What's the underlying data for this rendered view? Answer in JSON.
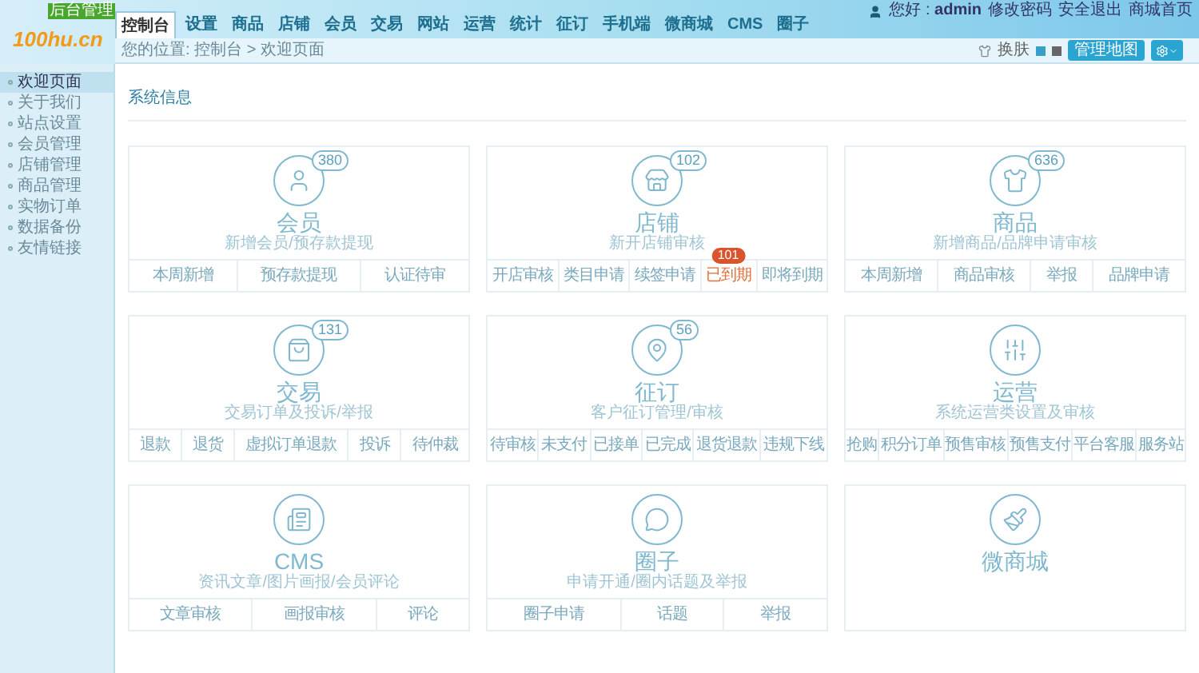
{
  "logo": {
    "text": "100hu.cn",
    "tag": "后台管理"
  },
  "nav": [
    {
      "label": "控制台",
      "selected": true
    },
    {
      "label": "设置",
      "selected": false
    },
    {
      "label": "商品",
      "selected": false
    },
    {
      "label": "店铺",
      "selected": false
    },
    {
      "label": "会员",
      "selected": false
    },
    {
      "label": "交易",
      "selected": false
    },
    {
      "label": "网站",
      "selected": false
    },
    {
      "label": "运营",
      "selected": false
    },
    {
      "label": "统计",
      "selected": false
    },
    {
      "label": "征订",
      "selected": false
    },
    {
      "label": "手机端",
      "selected": false
    },
    {
      "label": "微商城",
      "selected": false
    },
    {
      "label": "CMS",
      "selected": false
    },
    {
      "label": "圈子",
      "selected": false
    }
  ],
  "user": {
    "greeting": "您好 : ",
    "name": "admin",
    "links": [
      "修改密码",
      "安全退出",
      "商城首页"
    ]
  },
  "breadcrumb": "您的位置: 控制台 > 欢迎页面",
  "toolbar": {
    "skin": "换肤",
    "map_button": "管理地图"
  },
  "sidebar": [
    {
      "label": "欢迎页面",
      "selected": true
    },
    {
      "label": "关于我们",
      "selected": false
    },
    {
      "label": "站点设置",
      "selected": false
    },
    {
      "label": "会员管理",
      "selected": false
    },
    {
      "label": "店铺管理",
      "selected": false
    },
    {
      "label": "商品管理",
      "selected": false
    },
    {
      "label": "实物订单",
      "selected": false
    },
    {
      "label": "数据备份",
      "selected": false
    },
    {
      "label": "友情链接",
      "selected": false
    }
  ],
  "section_title": "系统信息",
  "cards": [
    {
      "kind": "user",
      "title": "会员",
      "count": "380",
      "desc": "新增会员/预存款提现",
      "links": [
        {
          "label": "本周新增"
        },
        {
          "label": "预存款提现"
        },
        {
          "label": "认证待审"
        }
      ]
    },
    {
      "kind": "store",
      "title": "店铺",
      "count": "102",
      "desc": "新开店铺审核",
      "links": [
        {
          "label": "开店审核"
        },
        {
          "label": "类目申请"
        },
        {
          "label": "续签申请"
        },
        {
          "label": "已到期",
          "badge": "101"
        },
        {
          "label": "即将到期"
        }
      ]
    },
    {
      "kind": "shirt",
      "title": "商品",
      "count": "636",
      "desc": "新增商品/品牌申请审核",
      "links": [
        {
          "label": "本周新增"
        },
        {
          "label": "商品审核"
        },
        {
          "label": "举报"
        },
        {
          "label": "品牌申请"
        }
      ]
    },
    {
      "kind": "bag",
      "title": "交易",
      "count": "131",
      "desc": "交易订单及投诉/举报",
      "links": [
        {
          "label": "退款"
        },
        {
          "label": "退货"
        },
        {
          "label": "虚拟订单退款"
        },
        {
          "label": "投诉"
        },
        {
          "label": "待仲裁"
        }
      ]
    },
    {
      "kind": "pin",
      "title": "征订",
      "count": "56",
      "desc": "客户征订管理/审核",
      "links": [
        {
          "label": "待审核"
        },
        {
          "label": "未支付"
        },
        {
          "label": "已接单"
        },
        {
          "label": "已完成"
        },
        {
          "label": "退货退款"
        },
        {
          "label": "违规下线"
        }
      ]
    },
    {
      "kind": "panel",
      "title": "运营",
      "desc": "系统运营类设置及审核",
      "links": [
        {
          "label": "抢购"
        },
        {
          "label": "积分订单"
        },
        {
          "label": "预售审核"
        },
        {
          "label": "预售支付"
        },
        {
          "label": "平台客服"
        },
        {
          "label": "服务站"
        }
      ]
    },
    {
      "kind": "news",
      "title": "CMS",
      "desc": "资讯文章/图片画报/会员评论",
      "links": [
        {
          "label": "文章审核"
        },
        {
          "label": "画报审核"
        },
        {
          "label": "评论"
        }
      ]
    },
    {
      "kind": "chat",
      "title": "圈子",
      "desc": "申请开通/圈内话题及举报",
      "links": [
        {
          "label": "圈子申请"
        },
        {
          "label": "话题"
        },
        {
          "label": "举报"
        }
      ]
    },
    {
      "kind": "brush",
      "title": "微商城"
    }
  ]
}
